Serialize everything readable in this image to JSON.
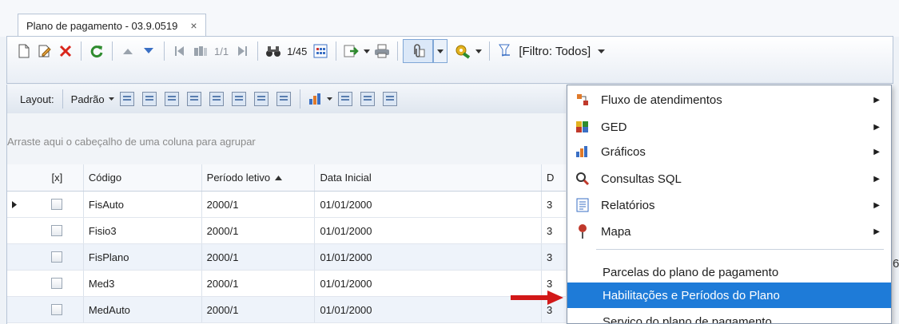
{
  "tab": {
    "title": "Plano de pagamento - 03.9.0519",
    "close": "×"
  },
  "toolbar": {
    "record_nav": "1/1",
    "find_count": "1/45",
    "filter_label": "[Filtro: Todos]"
  },
  "layoutbar": {
    "layout_label": "Layout:",
    "preset_label": "Padrão"
  },
  "group_hint": "Arraste aqui o cabeçalho de uma coluna para agrupar",
  "grid": {
    "columns": [
      "[x]",
      "Código",
      "Período letivo",
      "Data Inicial",
      "D"
    ],
    "rows": [
      {
        "codigo": "FisAuto",
        "periodo": "2000/1",
        "inicio": "01/01/2000",
        "d": "3"
      },
      {
        "codigo": "Fisio3",
        "periodo": "2000/1",
        "inicio": "01/01/2000",
        "d": "3"
      },
      {
        "codigo": "FisPlano",
        "periodo": "2000/1",
        "inicio": "01/01/2000",
        "d": "3"
      },
      {
        "codigo": "Med3",
        "periodo": "2000/1",
        "inicio": "01/01/2000",
        "d": "3"
      },
      {
        "codigo": "MedAuto",
        "periodo": "2000/1",
        "inicio": "01/01/2000",
        "d": "3"
      }
    ]
  },
  "menu": {
    "items": [
      {
        "label": "Fluxo de atendimentos",
        "icon": "workflow-icon"
      },
      {
        "label": "GED",
        "icon": "puzzle-icon"
      },
      {
        "label": "Gráficos",
        "icon": "bar-chart-icon"
      },
      {
        "label": "Consultas SQL",
        "icon": "magnifier-icon"
      },
      {
        "label": "Relatórios",
        "icon": "report-icon"
      },
      {
        "label": "Mapa",
        "icon": "map-pin-icon"
      }
    ],
    "actions": [
      "Parcelas do plano de pagamento",
      "Habilitações e Períodos do Plano",
      "Serviço do plano de pagamento"
    ]
  },
  "edge_char": "6",
  "colors": {
    "highlight": "#1e7bd8",
    "arrow": "#d21818",
    "accent_border": "#b7c4d6"
  }
}
